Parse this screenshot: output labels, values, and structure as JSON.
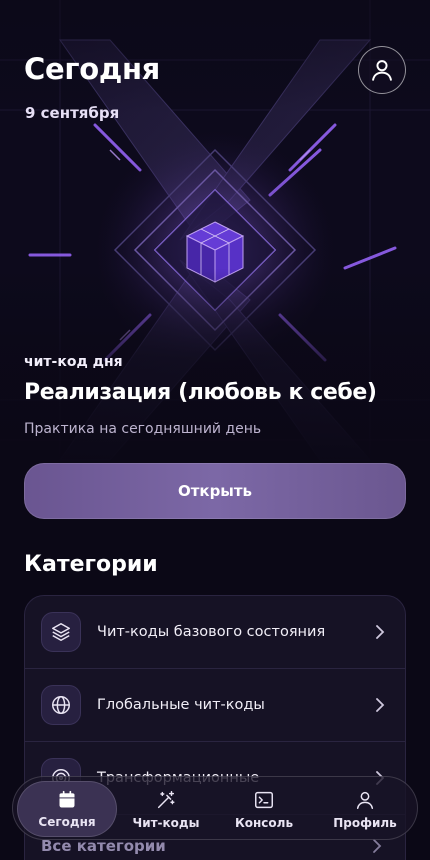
{
  "header": {
    "title": "Сегодня",
    "date": "9 сентября",
    "profile_icon": "user-icon"
  },
  "cheat_of_day": {
    "label": "чит-код дня",
    "title": "Реализация (любовь к себе)",
    "subtitle": "Практика на сегодняшний день",
    "button_label": "Открыть"
  },
  "categories": {
    "heading": "Категории",
    "items": [
      {
        "label": "Чит-коды базового состояния",
        "icon": "layers-icon"
      },
      {
        "label": "Глобальные чит-коды",
        "icon": "globe-icon"
      },
      {
        "label": "Трансформационные",
        "icon": "rings-icon"
      }
    ],
    "all_label": "Все категории"
  },
  "nav": {
    "items": [
      {
        "label": "Сегодня",
        "icon": "calendar-icon",
        "active": true
      },
      {
        "label": "Чит-коды",
        "icon": "magic-wand-icon",
        "active": false
      },
      {
        "label": "Консоль",
        "icon": "terminal-icon",
        "active": false
      },
      {
        "label": "Профиль",
        "icon": "user-icon",
        "active": false
      }
    ]
  },
  "colors": {
    "background": "#0b0816",
    "accent": "#7c68a6",
    "card": "#161225",
    "neon": "#8a5cff"
  }
}
